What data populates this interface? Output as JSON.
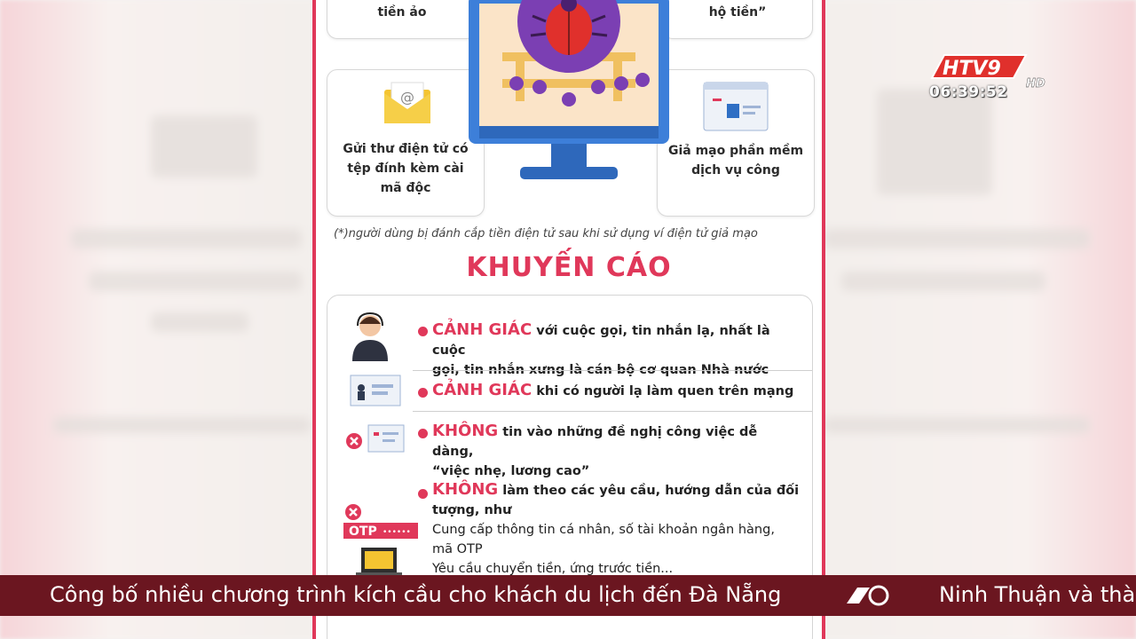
{
  "broadcast": {
    "channel": "HTV9",
    "hd": "HD",
    "clock": "06:39:52"
  },
  "infographic": {
    "top_left_card": "tiền ảo",
    "top_right_card": "hộ tiền”",
    "email_card": [
      "Gửi thư điện tử có",
      "tệp đính kèm cài",
      "mã độc"
    ],
    "software_card": [
      "Giả mạo phần mềm",
      "dịch vụ công"
    ],
    "footnote": "(*)người dùng bị đánh cắp tiền điện tử sau khi sử dụng ví điện tử giả mạo",
    "heading": "KHUYẾN CÁO",
    "advice": [
      {
        "keyword": "CẢNH GIÁC",
        "text": "với cuộc gọi, tin nhắn lạ, nhất là cuộc",
        "text2": "gọi, tin nhắn xưng là cán bộ cơ quan Nhà nước"
      },
      {
        "keyword": "CẢNH GIÁC",
        "text": "khi có người lạ làm quen trên mạng"
      },
      {
        "keyword": "KHÔNG",
        "text": "tin vào những đề nghị công việc dễ dàng,",
        "text2": "“việc  nhẹ, lương cao”"
      },
      {
        "keyword": "KHÔNG",
        "text": "làm theo các yêu cầu, hướng dẫn của đối",
        "text2": "tượng, như",
        "items": [
          "Cung cấp thông tin cá nhân, số tài khoản ngân hàng,",
          "mã OTP",
          "Yêu cầu chuyển tiền, ứng trước tiền..."
        ]
      }
    ],
    "otp_label": "OTP",
    "otp_mask": "••••••",
    "email_at": "@"
  },
  "ticker": {
    "headline_1": "Công bố nhiều chương trình kích cầu cho khách du lịch đến Đà Nẵng",
    "headline_2": "Ninh Thuận và thà"
  },
  "colors": {
    "accent": "#e0385a",
    "ticker_bg": "#6b1620",
    "monitor_blue": "#3d7fd9"
  }
}
